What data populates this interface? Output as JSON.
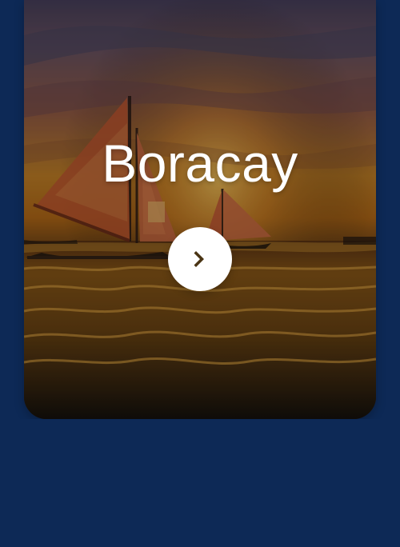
{
  "destination": {
    "name": "Boracay",
    "image_icon": "sunset-sailboats-image",
    "action_icon": "chevron-right-icon"
  },
  "colors": {
    "background": "#0d2956",
    "button": "#ffffff",
    "chevron": "#4a3414"
  }
}
